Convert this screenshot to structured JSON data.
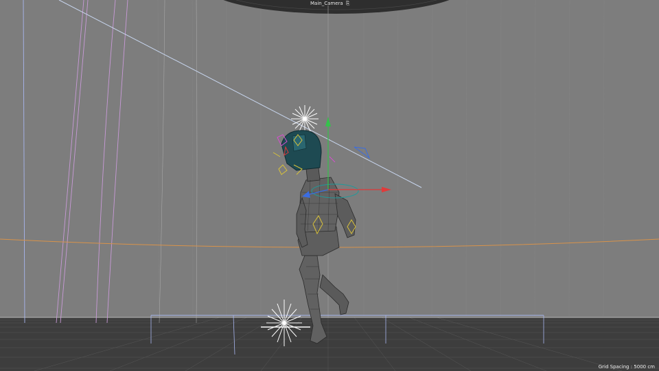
{
  "viewport": {
    "camera_name": "Main_Camera",
    "camera_icon": "camera-icon",
    "grid_spacing_text": "Grid Spacing : 5000 cm"
  },
  "colors": {
    "background": "#7d7d7d",
    "floor": "#3a3a3a",
    "grid_lines": "#5a5a5a",
    "horizon_orange": "#d9934a",
    "ray_light": "#c8d6ef",
    "guide_purple": "#c99ad8",
    "guide_blue": "#a8b6f0",
    "axis_x": "#e03a3a",
    "axis_y": "#35c24b",
    "axis_z": "#3b6de0",
    "rig_yellow": "#d9c23a",
    "rig_magenta": "#d64fd0",
    "helmet_teal": "#1e4a52",
    "mesh_dark": "#5a5a5a",
    "mesh_wire": "#2a2a2a"
  }
}
